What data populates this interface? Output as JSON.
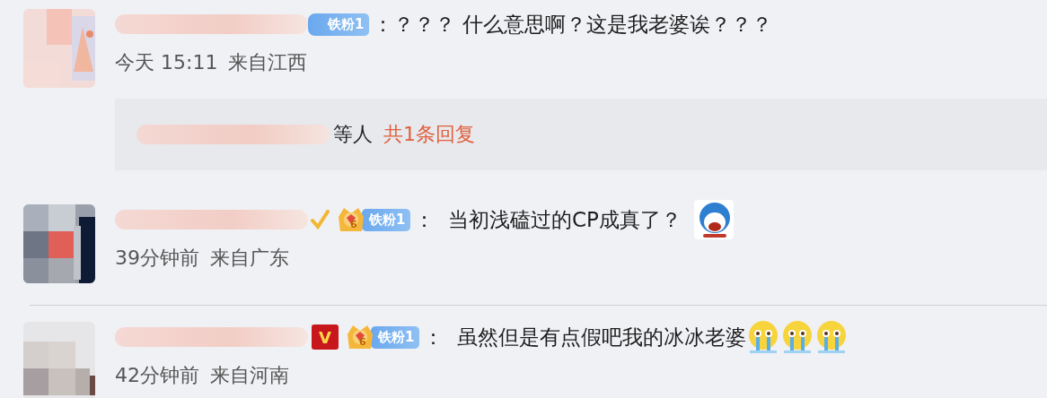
{
  "comments": [
    {
      "avatar": {
        "kind": "picture"
      },
      "badges": [
        {
          "kind": "fan",
          "label": "铁粉1"
        }
      ],
      "text": "：？？？ 什么意思啊？这是我老婆诶？？？",
      "time": "今天 15:11",
      "location": "来自江西",
      "reply_summary": {
        "suffix": "等人",
        "link": "共1条回复"
      }
    },
    {
      "avatar": {
        "kind": "picture"
      },
      "badges": [
        {
          "kind": "check"
        },
        {
          "kind": "crown",
          "label": "6"
        },
        {
          "kind": "fan",
          "label": "铁粉1"
        }
      ],
      "text": "：  当初浅磕过的CP成真了？",
      "emojis": [
        {
          "kind": "sticker"
        }
      ],
      "time": "39分钟前",
      "location": "来自广东"
    },
    {
      "kind": "divider"
    },
    {
      "avatar": {
        "kind": "picture"
      },
      "badges": [
        {
          "kind": "vip",
          "label": "V"
        },
        {
          "kind": "crown",
          "label": "6"
        },
        {
          "kind": "fan",
          "label": "铁粉1"
        }
      ],
      "text": "：  虽然但是有点假吧我的冰冰老婆",
      "emojis": [
        {
          "kind": "crying"
        },
        {
          "kind": "crying"
        },
        {
          "kind": "crying"
        }
      ],
      "time": "42分钟前",
      "location": "来自河南"
    }
  ]
}
